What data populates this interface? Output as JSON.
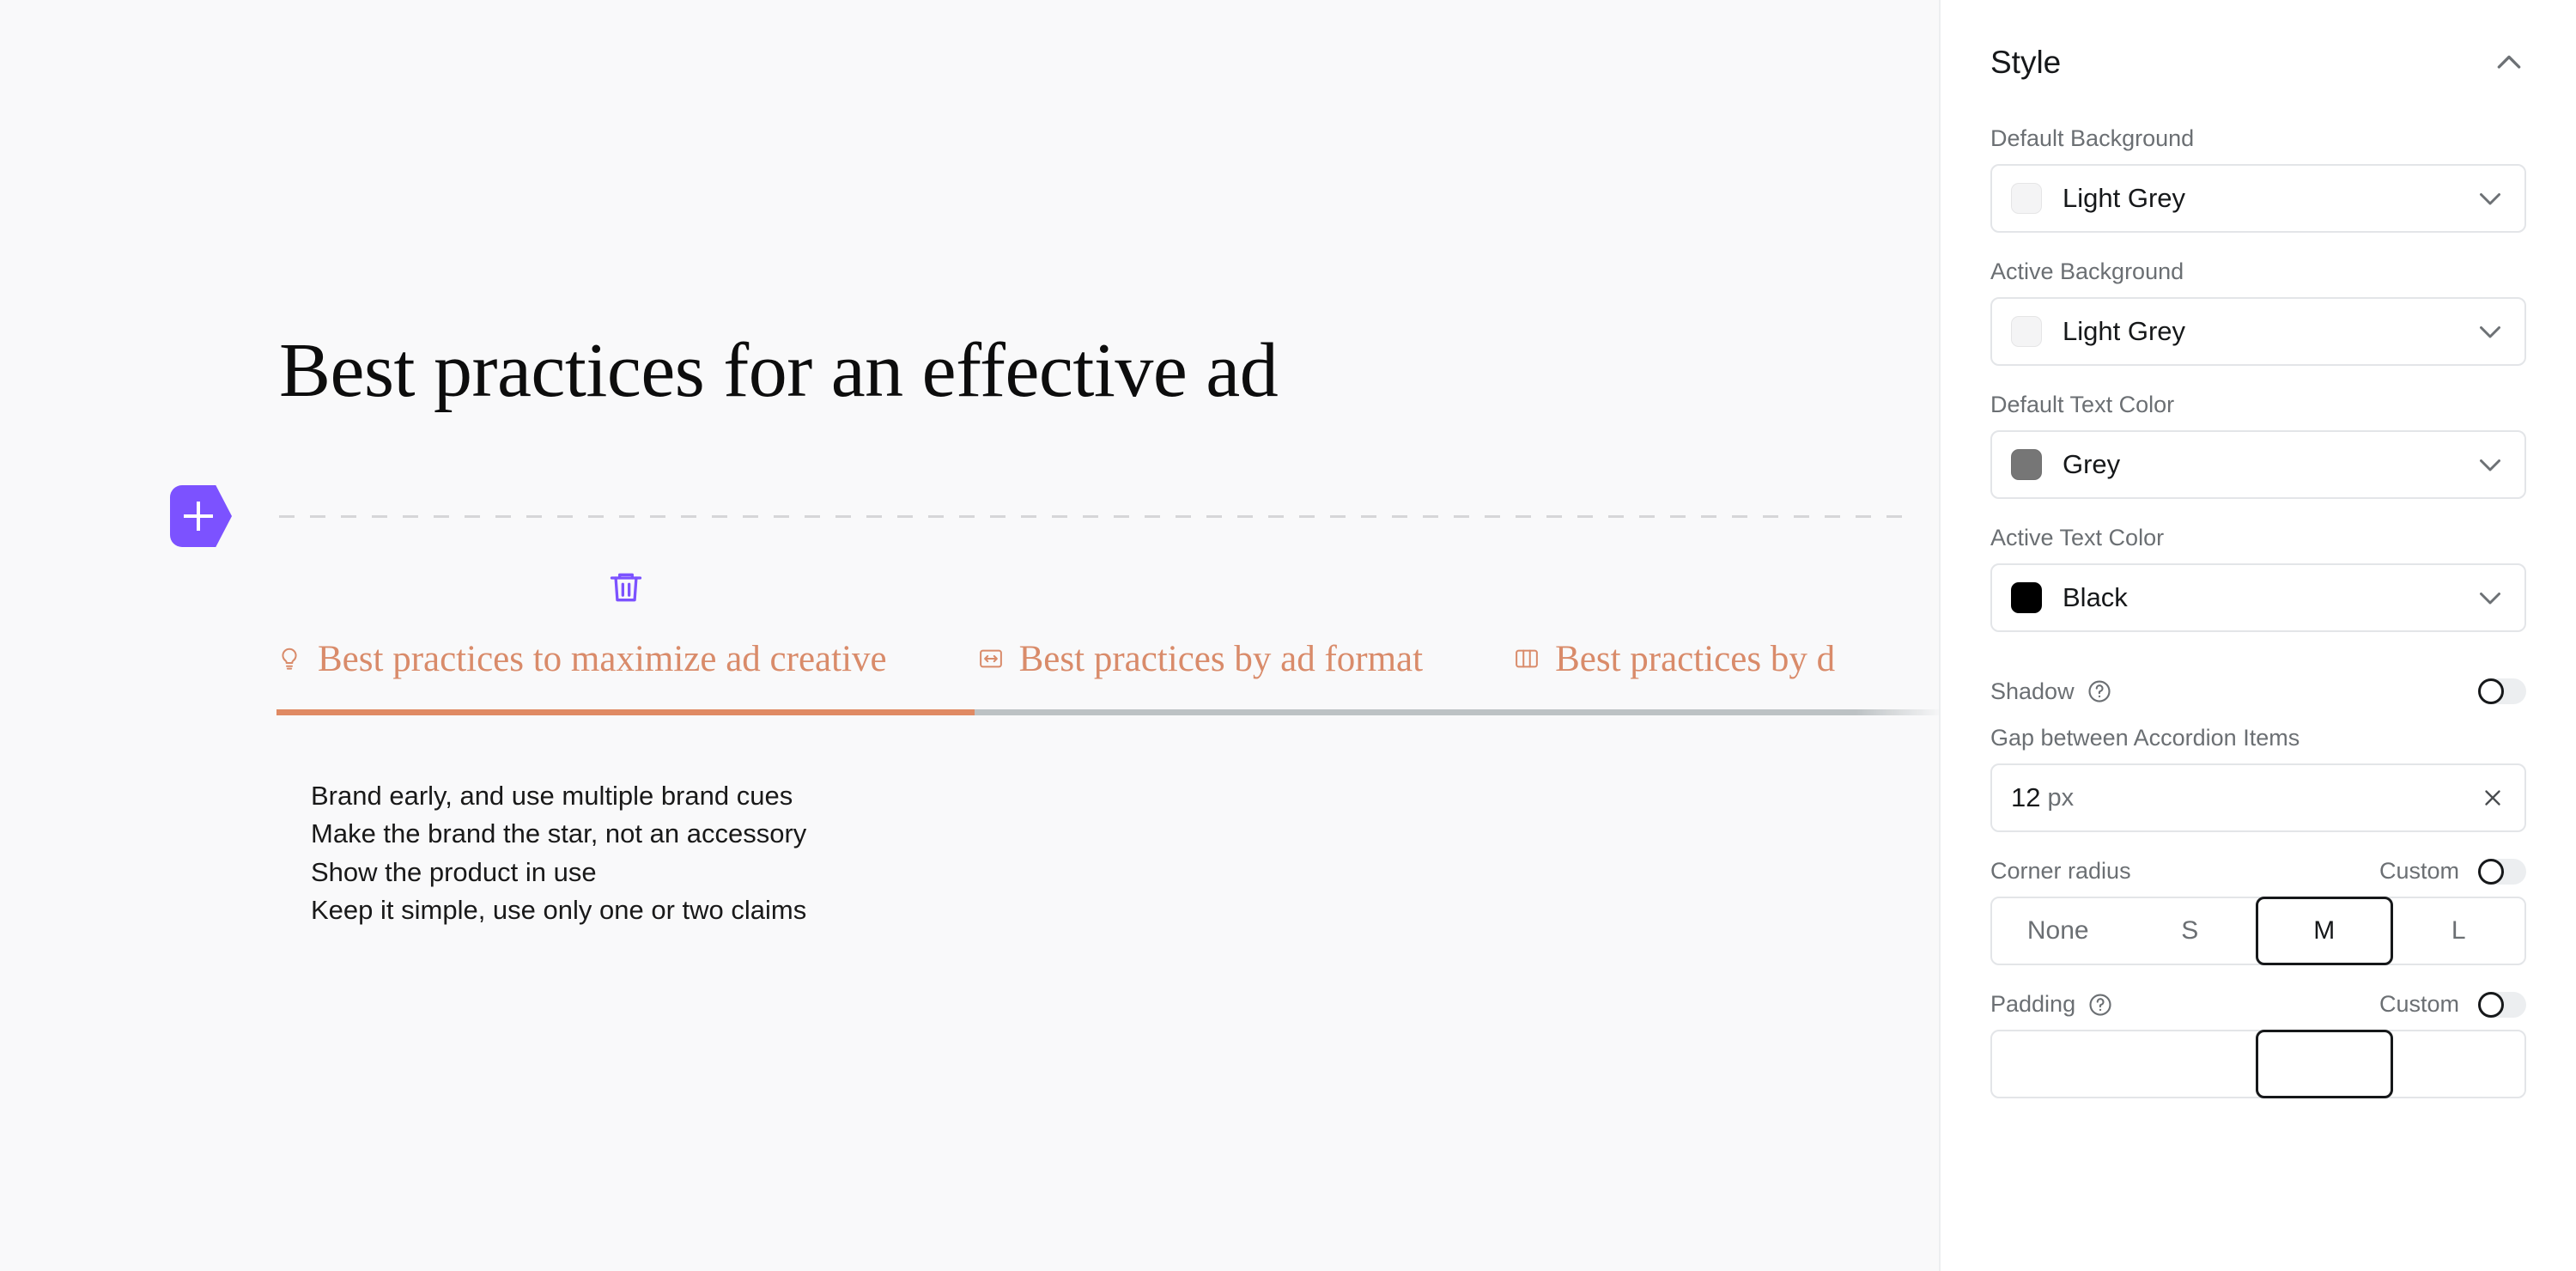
{
  "canvas": {
    "page_title": "Best practices for an effective ad",
    "add_block_button": {
      "icon": "plus-icon",
      "color": "#7c52ff"
    },
    "delete_icon": "trash-icon",
    "accordion": {
      "tabs": [
        {
          "label": "Best practices to maximize ad creative",
          "icon": "lightbulb-icon",
          "active": true
        },
        {
          "label": "Best practices by ad format",
          "icon": "horizontal-resize-icon",
          "active": false
        },
        {
          "label": "Best practices by d",
          "icon": "columns-icon",
          "active": false
        }
      ],
      "active_color": "#e08a63",
      "inactive_rule_color": "#bdc2c4",
      "body_text": "Brand early, and use multiple brand cues\nMake the brand the star, not an accessory\nShow the product in use\nKeep it simple, use only one or two claims"
    }
  },
  "sidebar": {
    "section_title": "Style",
    "collapse_icon": "chevron-up-icon",
    "fields": {
      "default_background": {
        "label": "Default Background",
        "value": "Light Grey",
        "swatch": "#f4f4f5"
      },
      "active_background": {
        "label": "Active Background",
        "value": "Light Grey",
        "swatch": "#f4f4f5"
      },
      "default_text_color": {
        "label": "Default Text Color",
        "value": "Grey",
        "swatch": "#767676"
      },
      "active_text_color": {
        "label": "Active Text Color",
        "value": "Black",
        "swatch": "#000000"
      },
      "shadow": {
        "label": "Shadow",
        "help_icon": "question-circle-icon",
        "toggle_state": "off"
      },
      "gap_between_accordion_items": {
        "label": "Gap between Accordion Items",
        "value": "12",
        "unit": "px",
        "clear_icon": "close-icon"
      },
      "corner_radius": {
        "label": "Corner radius",
        "custom_label": "Custom",
        "toggle_state": "off",
        "options": [
          "None",
          "S",
          "M",
          "L"
        ],
        "selected": "M"
      },
      "padding": {
        "label": "Padding",
        "help_icon": "question-circle-icon",
        "custom_label": "Custom",
        "toggle_state": "off"
      }
    }
  }
}
